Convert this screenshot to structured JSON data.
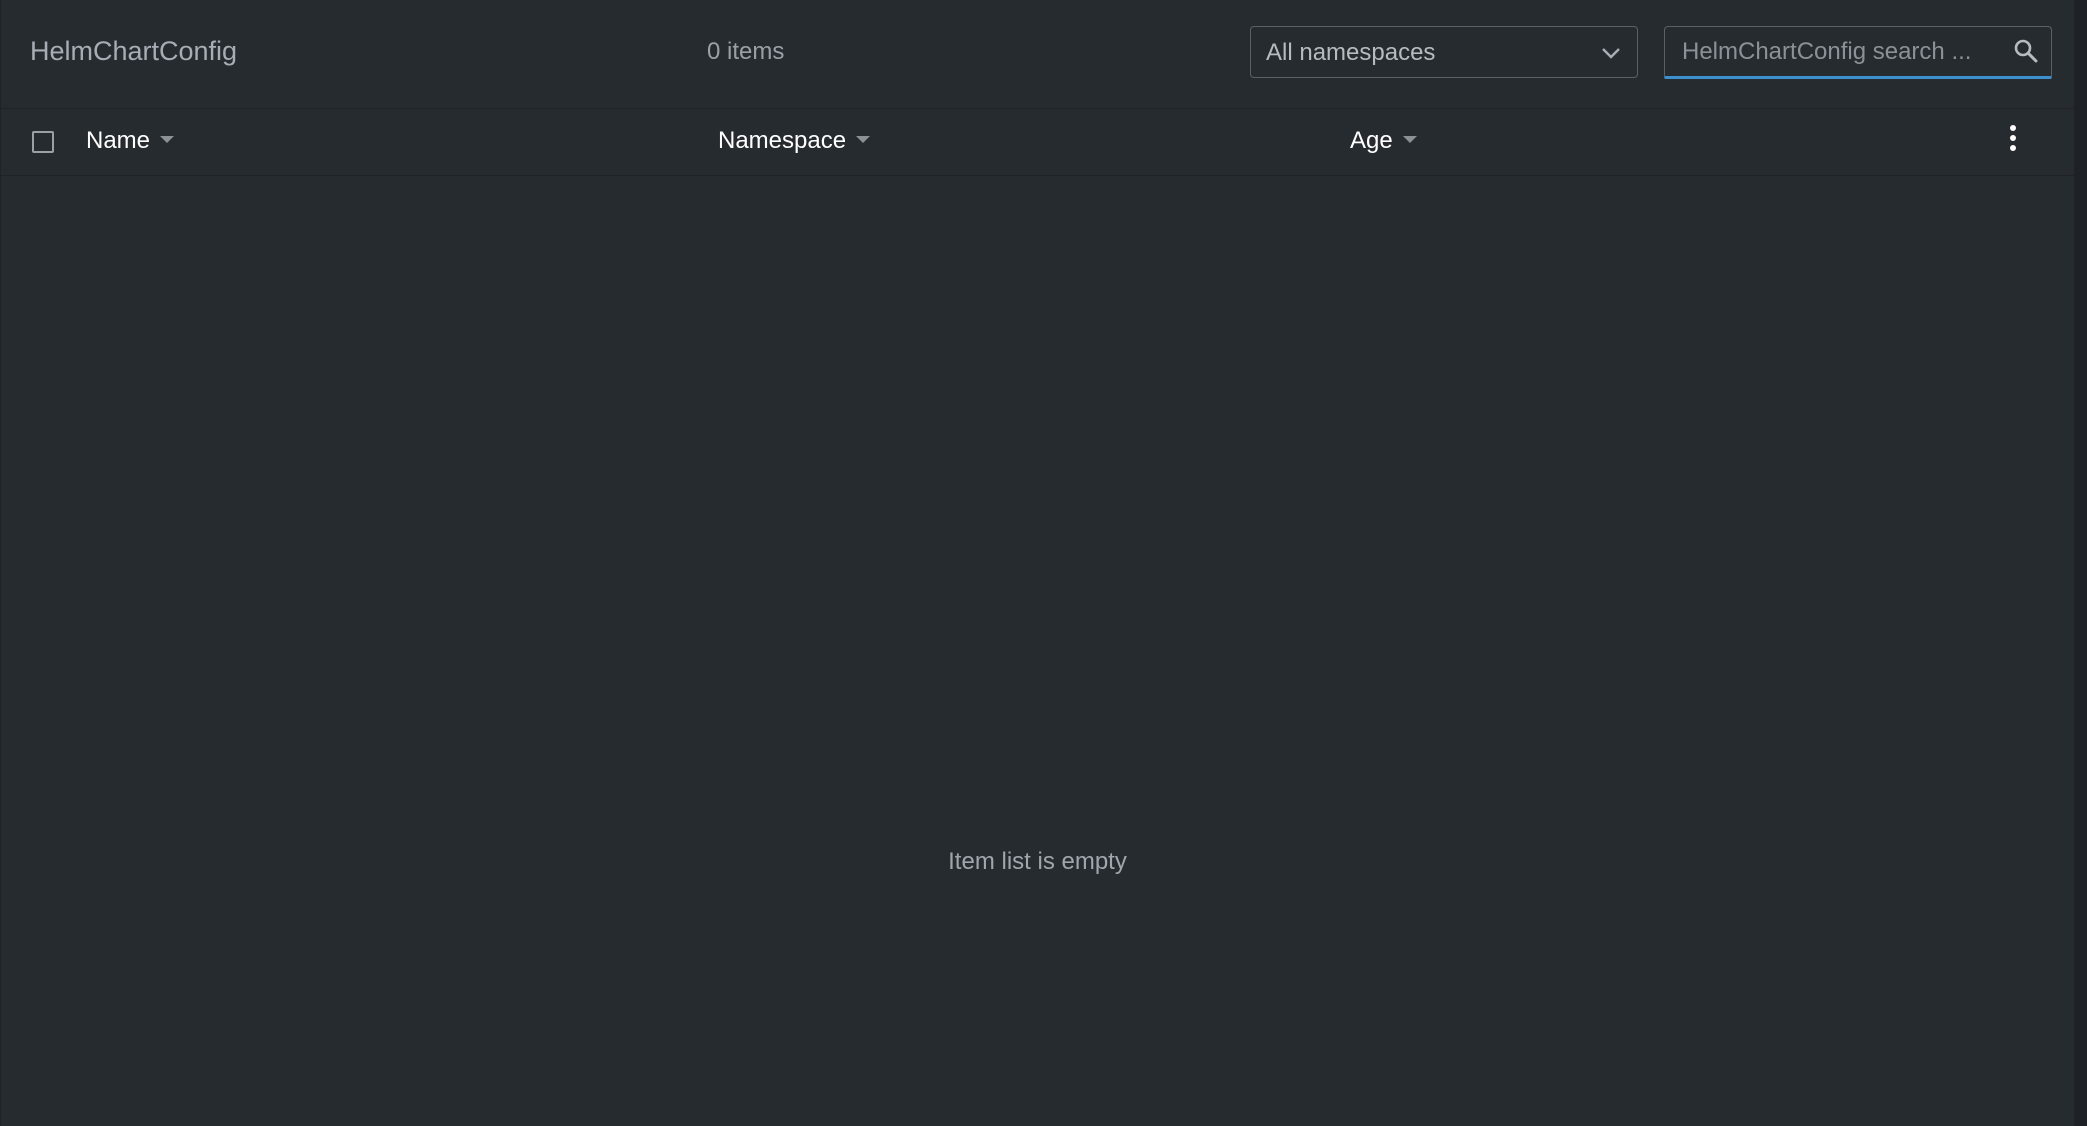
{
  "header": {
    "title": "HelmChartConfig",
    "item_count": "0 items",
    "namespace_select": {
      "selected": "All namespaces",
      "icon": "chevron-down-icon"
    },
    "search": {
      "placeholder": "HelmChartConfig search ...",
      "value": "",
      "icon": "search-icon"
    }
  },
  "table": {
    "columns": [
      {
        "label": "Name",
        "sort_icon": "sort-caret-icon"
      },
      {
        "label": "Namespace",
        "sort_icon": "sort-caret-icon"
      },
      {
        "label": "Age",
        "sort_icon": "sort-caret-icon"
      }
    ],
    "rows": [],
    "menu_icon": "vertical-dots-icon",
    "empty_message": "Item list is empty"
  },
  "colors": {
    "background": "#262b2f",
    "accent": "#3d90ce",
    "text_primary": "#ffffff",
    "text_muted": "#a0a6ac"
  }
}
